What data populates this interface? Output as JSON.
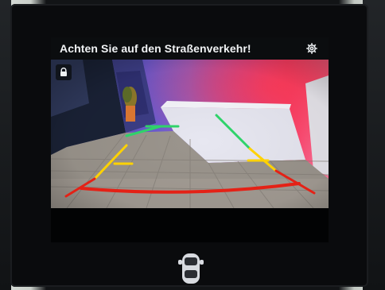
{
  "screen": {
    "header_text": "Achten Sie auf den Straßenverkehr!"
  },
  "icons": {
    "settings": "settings-gear-icon",
    "lock": "camera-lock-icon",
    "car": "car-top-view-icon"
  },
  "guide_lines": {
    "colors": {
      "near": "#e42116",
      "mid": "#ffd200",
      "far": "#2fd36a"
    }
  }
}
